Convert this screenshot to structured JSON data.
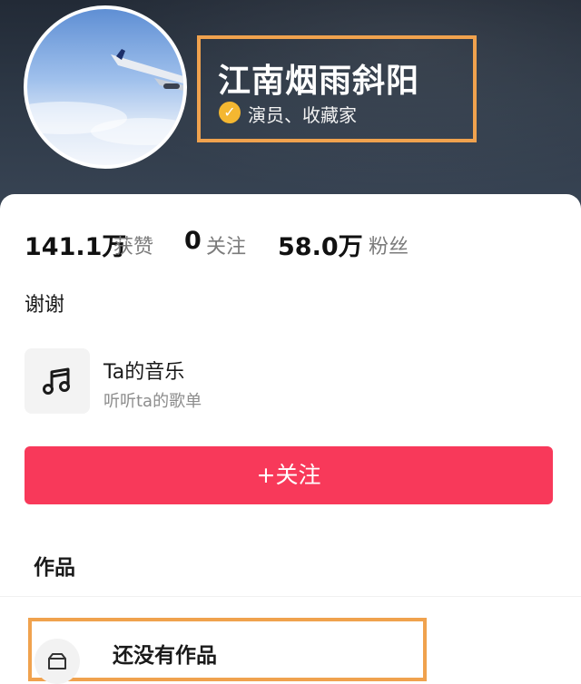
{
  "profile": {
    "name": "江南烟雨斜阳",
    "role": "演员、收藏家",
    "verified_icon": "check-icon",
    "bio": "谢谢"
  },
  "stats": {
    "likes_value": "141.1万",
    "likes_label": "获赞",
    "following_value": "0",
    "following_label": "关注",
    "followers_value": "58.0万",
    "followers_label": "粉丝"
  },
  "music": {
    "icon": "music-note-icon",
    "title": "Ta的音乐",
    "subtitle": "听听ta的歌单"
  },
  "follow_button": {
    "label": "+关注"
  },
  "works": {
    "title": "作品",
    "empty_title": "还没有作品",
    "empty_icon": "box-icon"
  },
  "colors": {
    "accent": "#f8395a",
    "highlight_border": "#f0a24e",
    "verified": "#f4b731"
  }
}
